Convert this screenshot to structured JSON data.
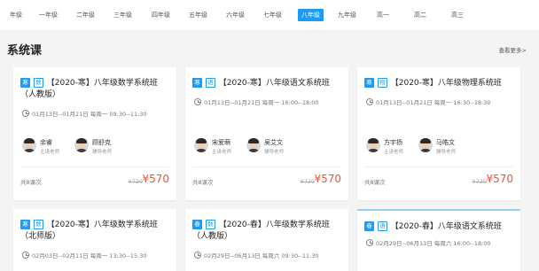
{
  "grades": [
    {
      "label": "年级",
      "active": false
    },
    {
      "label": "一年级",
      "active": false
    },
    {
      "label": "二年级",
      "active": false
    },
    {
      "label": "三年级",
      "active": false
    },
    {
      "label": "四年级",
      "active": false
    },
    {
      "label": "五年级",
      "active": false
    },
    {
      "label": "六年级",
      "active": false
    },
    {
      "label": "七年级",
      "active": false
    },
    {
      "label": "八年级",
      "active": true
    },
    {
      "label": "九年级",
      "active": false
    },
    {
      "label": "高一",
      "active": false
    },
    {
      "label": "高二",
      "active": false
    },
    {
      "label": "高三",
      "active": false
    }
  ],
  "section": {
    "title": "系统课",
    "more": "查看更多>"
  },
  "cards": [
    {
      "season": "寒",
      "subject": "数",
      "title": "【2020-寒】八年级数学系统班（人教版）",
      "time": "01月13日--01月21日  每周一 09:30--11:30",
      "teachers": [
        {
          "name": "余睿",
          "role": "主讲老师"
        },
        {
          "name": "顾舒克",
          "role": "辅导老师"
        }
      ],
      "lessons": "共8课次",
      "orig_price": "¥720",
      "price": "¥570"
    },
    {
      "season": "寒",
      "subject": "语",
      "title": "【2020-寒】八年级语文系统班",
      "time": "01月13日--01月21日  每周一 16:00--18:00",
      "teachers": [
        {
          "name": "宋爱萌",
          "role": "主讲老师"
        },
        {
          "name": "吴艾文",
          "role": "辅导老师"
        }
      ],
      "lessons": "共8课次",
      "orig_price": "¥720",
      "price": "¥570"
    },
    {
      "season": "寒",
      "subject": "物",
      "title": "【2020-寒】八年级物理系统班",
      "time": "01月13日--01月21日  每周一 16:30--18:30",
      "teachers": [
        {
          "name": "方宇扬",
          "role": "主讲老师"
        },
        {
          "name": "马皓文",
          "role": "辅导老师"
        }
      ],
      "lessons": "共8课次",
      "orig_price": "¥720",
      "price": "¥570"
    },
    {
      "season": "寒",
      "subject": "数",
      "title": "【2020-寒】八年级数学系统班（北师版）",
      "time": "02月03日--02月11日  每周一 13:30--15:30"
    },
    {
      "season": "春",
      "subject": "数",
      "title": "【2020-春】八年级数学系统班（人教版）",
      "time": "02月29日--06月13日  每周六 09:30--11:30"
    },
    {
      "season": "春",
      "subject": "语",
      "title": "【2020-春】八年级语文系统班",
      "time": "02月29日--06月13日  每周六 16:00--18:00"
    }
  ]
}
